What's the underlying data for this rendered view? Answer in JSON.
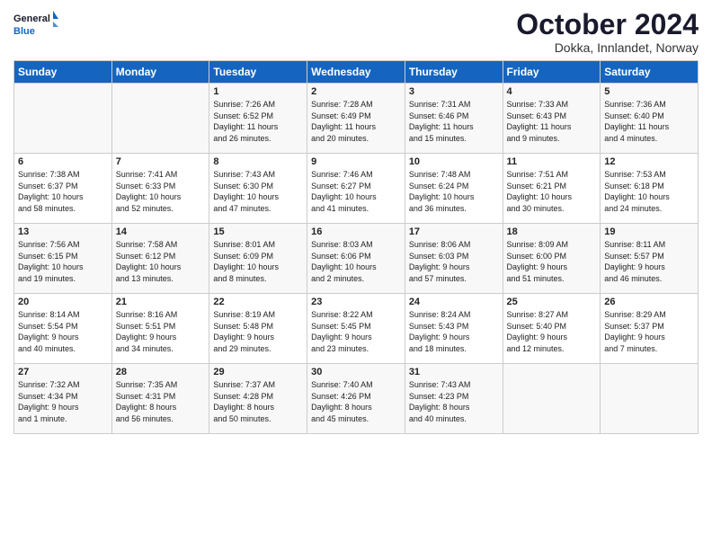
{
  "logo": {
    "line1": "General",
    "line2": "Blue"
  },
  "title": "October 2024",
  "subtitle": "Dokka, Innlandet, Norway",
  "days_header": [
    "Sunday",
    "Monday",
    "Tuesday",
    "Wednesday",
    "Thursday",
    "Friday",
    "Saturday"
  ],
  "weeks": [
    [
      {
        "day": "",
        "text": ""
      },
      {
        "day": "",
        "text": ""
      },
      {
        "day": "1",
        "text": "Sunrise: 7:26 AM\nSunset: 6:52 PM\nDaylight: 11 hours\nand 26 minutes."
      },
      {
        "day": "2",
        "text": "Sunrise: 7:28 AM\nSunset: 6:49 PM\nDaylight: 11 hours\nand 20 minutes."
      },
      {
        "day": "3",
        "text": "Sunrise: 7:31 AM\nSunset: 6:46 PM\nDaylight: 11 hours\nand 15 minutes."
      },
      {
        "day": "4",
        "text": "Sunrise: 7:33 AM\nSunset: 6:43 PM\nDaylight: 11 hours\nand 9 minutes."
      },
      {
        "day": "5",
        "text": "Sunrise: 7:36 AM\nSunset: 6:40 PM\nDaylight: 11 hours\nand 4 minutes."
      }
    ],
    [
      {
        "day": "6",
        "text": "Sunrise: 7:38 AM\nSunset: 6:37 PM\nDaylight: 10 hours\nand 58 minutes."
      },
      {
        "day": "7",
        "text": "Sunrise: 7:41 AM\nSunset: 6:33 PM\nDaylight: 10 hours\nand 52 minutes."
      },
      {
        "day": "8",
        "text": "Sunrise: 7:43 AM\nSunset: 6:30 PM\nDaylight: 10 hours\nand 47 minutes."
      },
      {
        "day": "9",
        "text": "Sunrise: 7:46 AM\nSunset: 6:27 PM\nDaylight: 10 hours\nand 41 minutes."
      },
      {
        "day": "10",
        "text": "Sunrise: 7:48 AM\nSunset: 6:24 PM\nDaylight: 10 hours\nand 36 minutes."
      },
      {
        "day": "11",
        "text": "Sunrise: 7:51 AM\nSunset: 6:21 PM\nDaylight: 10 hours\nand 30 minutes."
      },
      {
        "day": "12",
        "text": "Sunrise: 7:53 AM\nSunset: 6:18 PM\nDaylight: 10 hours\nand 24 minutes."
      }
    ],
    [
      {
        "day": "13",
        "text": "Sunrise: 7:56 AM\nSunset: 6:15 PM\nDaylight: 10 hours\nand 19 minutes."
      },
      {
        "day": "14",
        "text": "Sunrise: 7:58 AM\nSunset: 6:12 PM\nDaylight: 10 hours\nand 13 minutes."
      },
      {
        "day": "15",
        "text": "Sunrise: 8:01 AM\nSunset: 6:09 PM\nDaylight: 10 hours\nand 8 minutes."
      },
      {
        "day": "16",
        "text": "Sunrise: 8:03 AM\nSunset: 6:06 PM\nDaylight: 10 hours\nand 2 minutes."
      },
      {
        "day": "17",
        "text": "Sunrise: 8:06 AM\nSunset: 6:03 PM\nDaylight: 9 hours\nand 57 minutes."
      },
      {
        "day": "18",
        "text": "Sunrise: 8:09 AM\nSunset: 6:00 PM\nDaylight: 9 hours\nand 51 minutes."
      },
      {
        "day": "19",
        "text": "Sunrise: 8:11 AM\nSunset: 5:57 PM\nDaylight: 9 hours\nand 46 minutes."
      }
    ],
    [
      {
        "day": "20",
        "text": "Sunrise: 8:14 AM\nSunset: 5:54 PM\nDaylight: 9 hours\nand 40 minutes."
      },
      {
        "day": "21",
        "text": "Sunrise: 8:16 AM\nSunset: 5:51 PM\nDaylight: 9 hours\nand 34 minutes."
      },
      {
        "day": "22",
        "text": "Sunrise: 8:19 AM\nSunset: 5:48 PM\nDaylight: 9 hours\nand 29 minutes."
      },
      {
        "day": "23",
        "text": "Sunrise: 8:22 AM\nSunset: 5:45 PM\nDaylight: 9 hours\nand 23 minutes."
      },
      {
        "day": "24",
        "text": "Sunrise: 8:24 AM\nSunset: 5:43 PM\nDaylight: 9 hours\nand 18 minutes."
      },
      {
        "day": "25",
        "text": "Sunrise: 8:27 AM\nSunset: 5:40 PM\nDaylight: 9 hours\nand 12 minutes."
      },
      {
        "day": "26",
        "text": "Sunrise: 8:29 AM\nSunset: 5:37 PM\nDaylight: 9 hours\nand 7 minutes."
      }
    ],
    [
      {
        "day": "27",
        "text": "Sunrise: 7:32 AM\nSunset: 4:34 PM\nDaylight: 9 hours\nand 1 minute."
      },
      {
        "day": "28",
        "text": "Sunrise: 7:35 AM\nSunset: 4:31 PM\nDaylight: 8 hours\nand 56 minutes."
      },
      {
        "day": "29",
        "text": "Sunrise: 7:37 AM\nSunset: 4:28 PM\nDaylight: 8 hours\nand 50 minutes."
      },
      {
        "day": "30",
        "text": "Sunrise: 7:40 AM\nSunset: 4:26 PM\nDaylight: 8 hours\nand 45 minutes."
      },
      {
        "day": "31",
        "text": "Sunrise: 7:43 AM\nSunset: 4:23 PM\nDaylight: 8 hours\nand 40 minutes."
      },
      {
        "day": "",
        "text": ""
      },
      {
        "day": "",
        "text": ""
      }
    ]
  ]
}
